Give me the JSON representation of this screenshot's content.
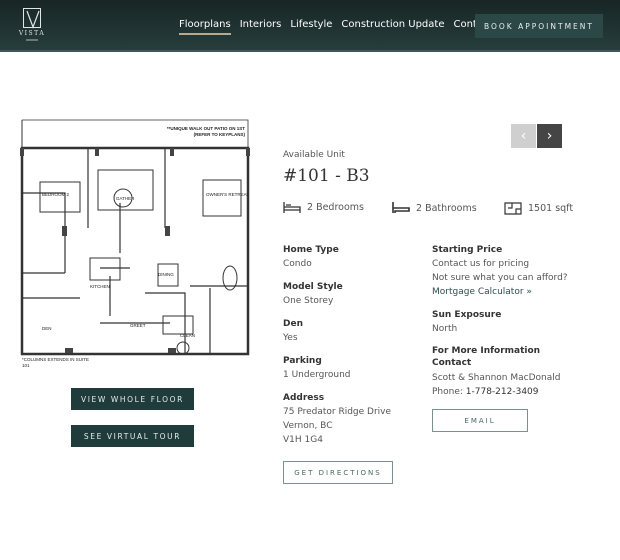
{
  "header": {
    "logo_text": "VISTA",
    "nav": [
      {
        "label": "Floorplans",
        "active": true
      },
      {
        "label": "Interiors"
      },
      {
        "label": "Lifestyle"
      },
      {
        "label": "Construction Update"
      },
      {
        "label": "Contact"
      }
    ],
    "book_label": "BOOK APPOINTMENT"
  },
  "floorplan": {
    "note_top": "**UNIQUE WALK OUT PATIO ON 1ST",
    "note_top2": "(REFER TO KEYPLANS)",
    "rooms": [
      "BEDROOM 2",
      "GATHER",
      "OWNER'S RETREAT",
      "KITCHEN",
      "DINING",
      "DEN",
      "GREET",
      "CLEAN"
    ],
    "note_bottom": "*COLUMNS EXTENDS IN SUITE",
    "unit_num": "101",
    "view_floor_label": "VIEW WHOLE FLOOR",
    "virtual_tour_label": "SEE VIRTUAL TOUR"
  },
  "pager": {
    "prev_icon": "chevron-left-icon",
    "next_icon": "chevron-right-icon"
  },
  "unit": {
    "eyebrow": "Available Unit",
    "title": "#101 - B3",
    "features": [
      {
        "icon": "bed-icon",
        "label": "2 Bedrooms"
      },
      {
        "icon": "bathtub-icon",
        "label": "2 Bathrooms"
      },
      {
        "icon": "floorplan-icon",
        "label": "1501 sqft"
      }
    ]
  },
  "details_left": [
    {
      "label": "Home Type",
      "value": "Condo"
    },
    {
      "label": "Model Style",
      "value": "One Storey"
    },
    {
      "label": "Den",
      "value": "Yes"
    },
    {
      "label": "Parking",
      "value": "1 Underground"
    },
    {
      "label": "Address",
      "lines": [
        "75 Predator Ridge Drive",
        "Vernon, BC",
        "V1H 1G4"
      ]
    }
  ],
  "details_right": {
    "price_label": "Starting Price",
    "price_value": "Contact us for pricing",
    "afford_text": "Not sure what you can afford?",
    "mortgage_link": "Mortgage Calculator »",
    "sun_label": "Sun Exposure",
    "sun_value": "North",
    "info_label": "For More Information Contact",
    "contact_name": "Scott & Shannon MacDonald",
    "phone_prefix": "Phone: ",
    "phone": "1-778-212-3409"
  },
  "buttons": {
    "email": "EMAIL",
    "directions": "GET DIRECTIONS"
  },
  "colors": {
    "header": "#1f3332",
    "accent": "#1f3b3b",
    "active_underline": "#b9a98a"
  }
}
